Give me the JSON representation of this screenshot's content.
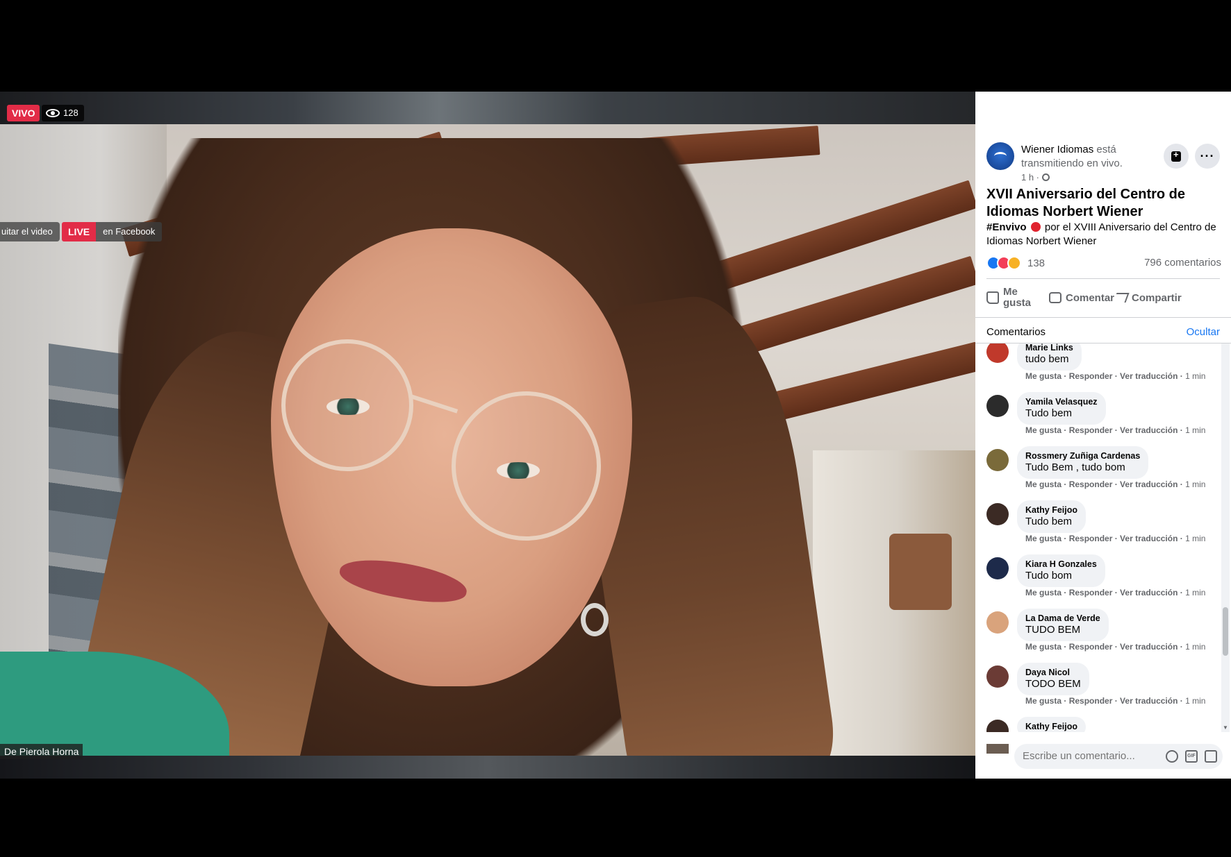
{
  "video": {
    "live_badge": "VIVO",
    "viewer_count": "128",
    "quit_label": "uitar el video",
    "live_tag": "LIVE",
    "live_suffix": "en Facebook",
    "speaker_name": "De Pierola Horna"
  },
  "post": {
    "page_name": "Wiener Idiomas",
    "status_word": "está",
    "status_rest": "transmitiendo en vivo.",
    "time": "1 h ·",
    "title": "XVII Aniversario del Centro de Idiomas Norbert Wiener",
    "hashtag": "#Envivo",
    "body": "por el XVIII Aniversario del Centro de Idiomas Norbert Wiener",
    "reaction_count": "138",
    "comment_count": "796 comentarios",
    "actions": {
      "like": "Me gusta",
      "comment": "Comentar",
      "share": "Compartir"
    }
  },
  "comments_header": {
    "title": "Comentarios",
    "hide": "Ocultar"
  },
  "comments": [
    {
      "name": "Marie Links",
      "text": "tudo bem",
      "like": "Me gusta",
      "reply": "Responder",
      "translate": "Ver traducción",
      "time": "1 min"
    },
    {
      "name": "Yamila Velasquez",
      "text": "Tudo bem",
      "like": "Me gusta",
      "reply": "Responder",
      "translate": "Ver traducción",
      "time": "1 min"
    },
    {
      "name": "Rossmery Zuñiga Cardenas",
      "text": "Tudo Bem , tudo bom",
      "like": "Me gusta",
      "reply": "Responder",
      "translate": "Ver traducción",
      "time": "1 min"
    },
    {
      "name": "Kathy Feijoo",
      "text": "Tudo bem",
      "like": "Me gusta",
      "reply": "Responder",
      "translate": "Ver traducción",
      "time": "1 min"
    },
    {
      "name": "Kiara H Gonzales",
      "text": "Tudo bom",
      "like": "Me gusta",
      "reply": "Responder",
      "translate": "Ver traducción",
      "time": "1 min"
    },
    {
      "name": "La Dama de Verde",
      "text": "TUDO BEM",
      "like": "Me gusta",
      "reply": "Responder",
      "translate": "Ver traducción",
      "time": "1 min"
    },
    {
      "name": "Daya Nicol",
      "text": "TODO BEM",
      "like": "Me gusta",
      "reply": "Responder",
      "translate": "Ver traducción",
      "time": "1 min"
    },
    {
      "name": "Kathy Feijoo",
      "text": "",
      "like": "",
      "reply": "",
      "translate": "",
      "time": ""
    }
  ],
  "composer": {
    "placeholder": "Escribe un comentario..."
  },
  "colors": {
    "live_red": "#e22c47",
    "facebook_blue": "#1877f2",
    "bubble_gray": "#f0f2f5"
  }
}
